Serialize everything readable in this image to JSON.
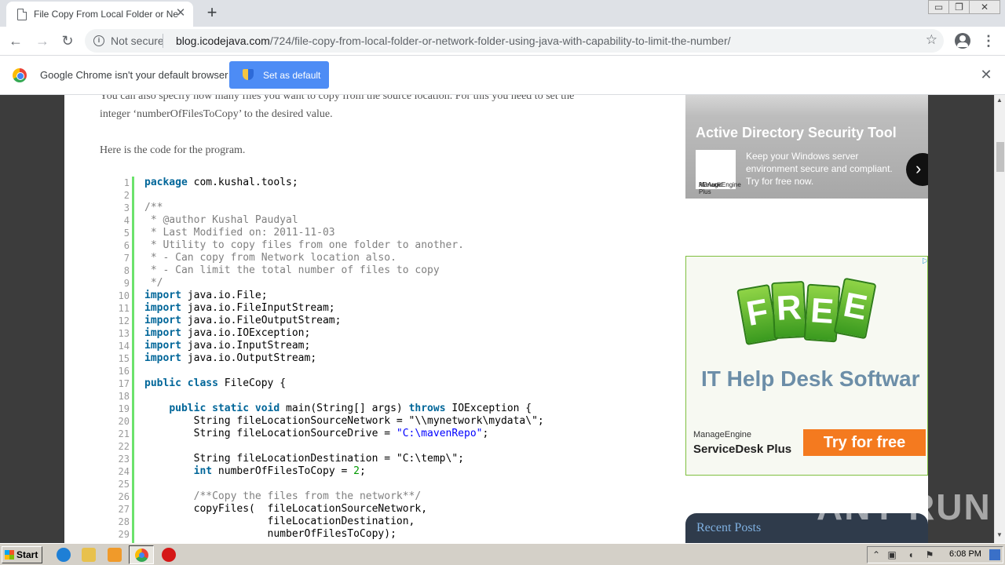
{
  "browser": {
    "tab_title": "File Copy From Local Folder or Network Folder",
    "tab_close": "✕",
    "new_tab": "+",
    "window_min": "▭",
    "window_max": "❐",
    "window_close": "✕",
    "security_label": "Not secure",
    "url_host": "blog.icodejava.com",
    "url_path": "/724/file-copy-from-local-folder-or-network-folder-using-java-with-capability-to-limit-the-number/"
  },
  "infobar": {
    "message": "Google Chrome isn't your default browser",
    "button_label": "Set as default"
  },
  "article": {
    "para1_line1": "You can also specify how many files you want to copy from the source location. For this you need to set the",
    "para1_line2": "integer ‘numberOfFilesToCopy’ to the desired value.",
    "para2": "Here is the code for the program.",
    "line_numbers": [
      "1",
      "2",
      "3",
      "4",
      "5",
      "6",
      "7",
      "8",
      "9",
      "10",
      "11",
      "12",
      "13",
      "14",
      "15",
      "16",
      "17",
      "18",
      "19",
      "20",
      "21",
      "22",
      "23",
      "24",
      "25",
      "26",
      "27",
      "28",
      "29"
    ]
  },
  "ads": {
    "ad1_title": "Active Directory Security Tool",
    "ad1_logo_top": "ManageEngine",
    "ad1_logo_bottom": "ADAudit Plus",
    "ad1_text": "Keep your Windows server environment secure and compliant. Try for free now.",
    "ad2_tags": [
      "F",
      "R",
      "E",
      "E"
    ],
    "ad2_headline": "IT Help Desk Softwar",
    "ad2_brand_small": "ManageEngine",
    "ad2_brand_big": "ServiceDesk Plus",
    "ad2_cta": "Try for free"
  },
  "sidebar": {
    "recent_posts": "Recent Posts"
  },
  "watermark": "ANY RUN",
  "taskbar": {
    "start_label": "Start",
    "clock": "6:08 PM"
  }
}
